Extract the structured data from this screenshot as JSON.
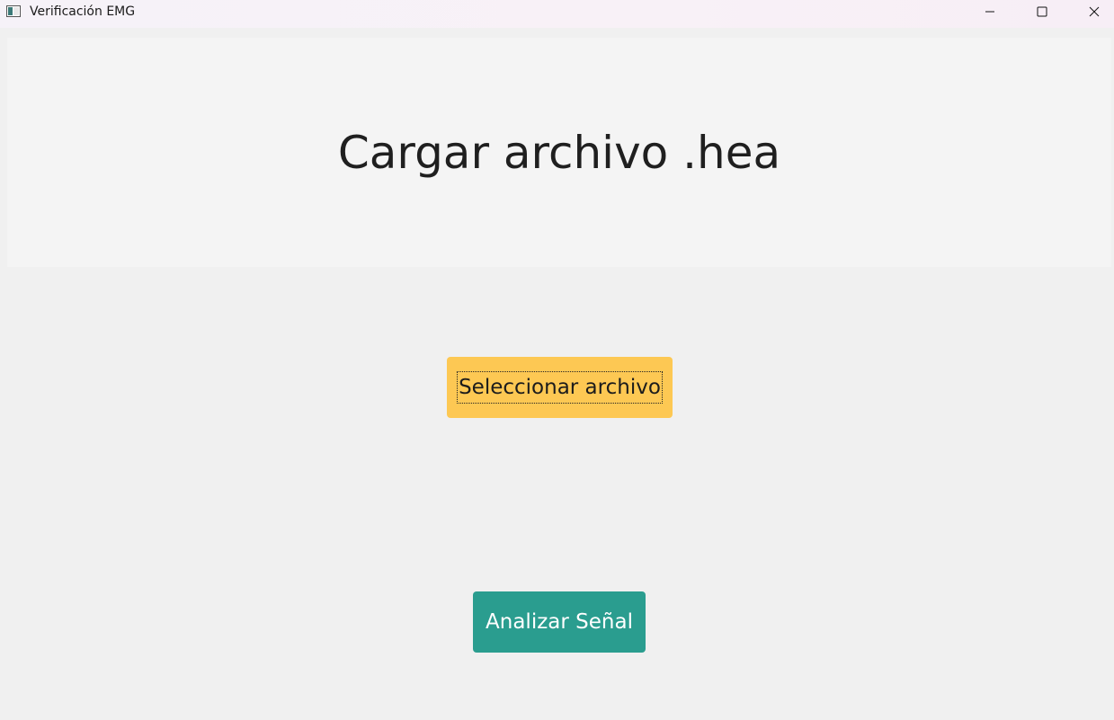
{
  "window": {
    "title": "Verificación EMG",
    "icon": "app-window-icon",
    "controls": {
      "minimize": "minimize-icon",
      "maximize": "maximize-icon",
      "close": "close-icon"
    }
  },
  "header": {
    "title": "Cargar archivo .hea"
  },
  "actions": {
    "select_label": "Seleccionar archivo",
    "analyze_label": "Analizar Señal"
  },
  "colors": {
    "select_button": "#fdc853",
    "analyze_button": "#2a9d8f",
    "background": "#f0f0f0",
    "header_panel": "#f4f4f4"
  }
}
